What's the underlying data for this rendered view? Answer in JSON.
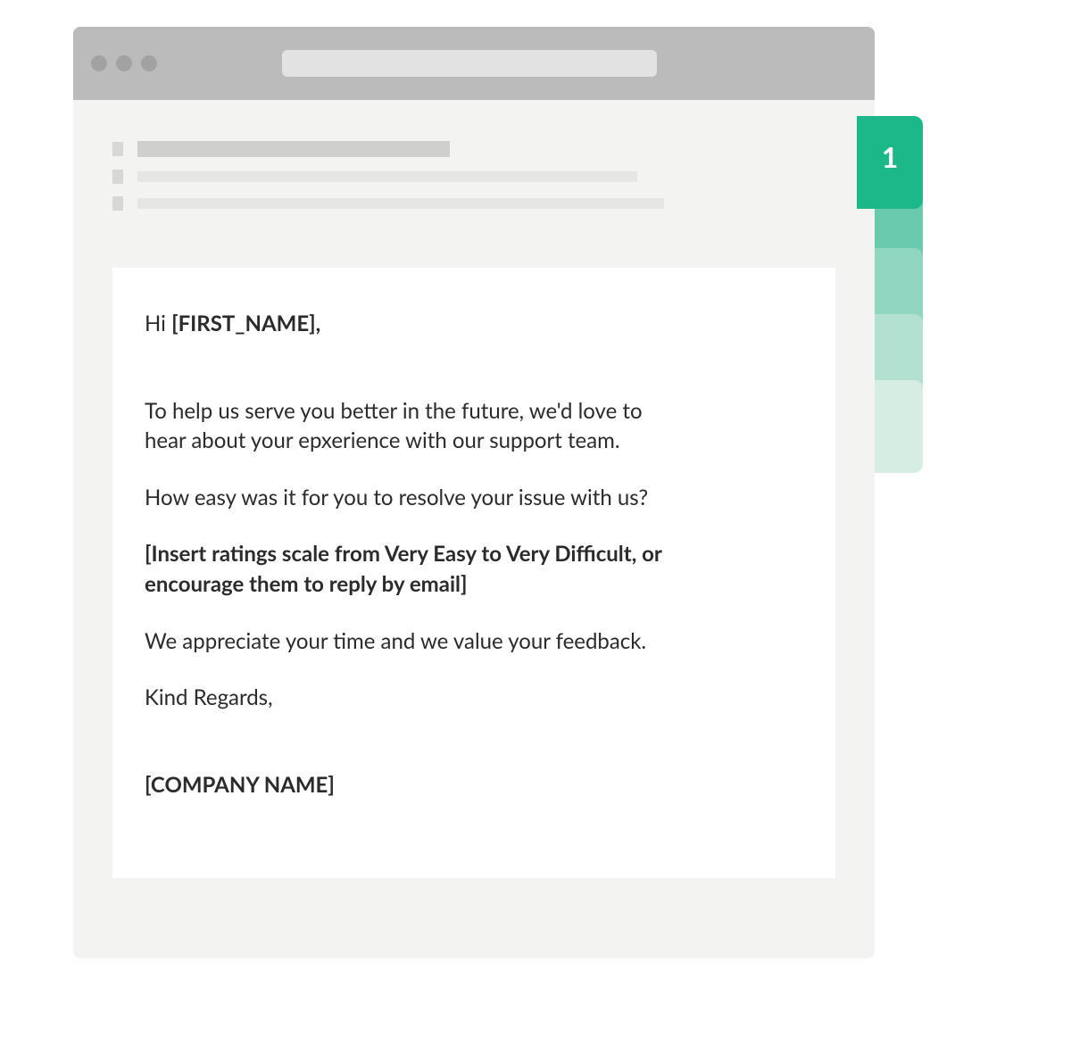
{
  "tabs": {
    "active_index": 0,
    "items": [
      "1",
      "",
      "",
      "",
      ""
    ]
  },
  "email": {
    "greeting_prefix": "Hi ",
    "greeting_name": "[FIRST_NAME],",
    "p1": "To help us serve you better in the future, we'd love to hear about your epxerience with our support team.",
    "p2": "How easy was it for you to resolve your issue with us?",
    "scale_note": "[Insert ratings scale from Very Easy to Very Difficult, or encourage them to reply by email]",
    "p3": "We appreciate your time and we value your feedback.",
    "signoff": "Kind Regards,",
    "company": "[COMPANY NAME]"
  }
}
